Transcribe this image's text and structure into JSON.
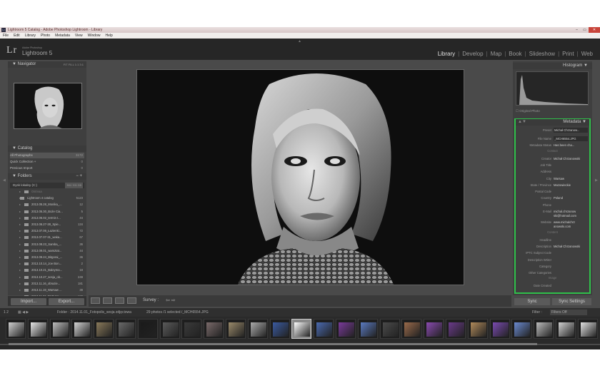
{
  "window": {
    "title": "Lightroom 5 Catalog - Adobe Photoshop Lightroom - Library",
    "icon": "Lr",
    "controls": [
      "–",
      "▭",
      "✕"
    ]
  },
  "menu": [
    "File",
    "Edit",
    "Library",
    "Photo",
    "Metadata",
    "View",
    "Window",
    "Help"
  ],
  "identity": {
    "logo": "Lr",
    "sub1": "Adobe Photoshop",
    "sub2": "Lightroom 5"
  },
  "modules": [
    {
      "label": "Library",
      "active": true
    },
    {
      "label": "Develop"
    },
    {
      "label": "Map"
    },
    {
      "label": "Book"
    },
    {
      "label": "Slideshow"
    },
    {
      "label": "Print"
    },
    {
      "label": "Web"
    }
  ],
  "left": {
    "navigator": {
      "title": "Navigator",
      "zoom": "FIT   FILL   1:1   3:1"
    },
    "catalog": {
      "title": "Catalog",
      "items": [
        {
          "label": "All Photographs",
          "count": "3172"
        },
        {
          "label": "Quick Collection +",
          "count": "0"
        },
        {
          "label": "Previous Import",
          "count": "0"
        }
      ]
    },
    "folders": {
      "title": "Folders",
      "volume": {
        "label": "Dysk lokalny (C:)",
        "space": "306 / 931 GB"
      },
      "items": [
        {
          "label": "Ostrvaa",
          "count": ""
        },
        {
          "label": "Lightroom 4 catalog",
          "count": "5123"
        },
        {
          "label": "2013.05.28_Monika_...",
          "count": "12"
        },
        {
          "label": "2013.05.30_Boże Cia...",
          "count": "5"
        },
        {
          "label": "2013.06.02_termin t...",
          "count": "44"
        },
        {
          "label": "2013.06.27-28_Spie...",
          "count": "134"
        },
        {
          "label": "2013.07.06_Łazienki...",
          "count": "72"
        },
        {
          "label": "2013.07.07-31_waka...",
          "count": "67"
        },
        {
          "label": "2013.08.23_Samba_...",
          "count": "36"
        },
        {
          "label": "2013.09.01_warsztat...",
          "count": "44"
        },
        {
          "label": "2013.09.24_Bitgorai_...",
          "count": "36"
        },
        {
          "label": "2013.10.14_Joe Bon...",
          "count": "2"
        },
        {
          "label": "2013.10.21_Baleyma...",
          "count": "18"
        },
        {
          "label": "2013.10.27_sesja_ob...",
          "count": "249"
        },
        {
          "label": "2013.11.16_obrazie...",
          "count": "181"
        },
        {
          "label": "2013.11.19_Warsaw ...",
          "count": "38"
        },
        {
          "label": "2013.11.21_D&D Int...",
          "count": "130"
        }
      ]
    },
    "buttons": {
      "import": "Import...",
      "export": "Export..."
    }
  },
  "toolbar": {
    "survey": "Survey :",
    "arrows": "⇦ ⇨"
  },
  "right": {
    "histogram": {
      "title": "Histogram",
      "original": "Original Photo"
    },
    "metadata": {
      "title": "Metadata",
      "preset_label": "Preset",
      "preset_value": "Michał Chrzanow...",
      "rows": [
        {
          "k": "File Name",
          "v": "_MCH6554.JPG",
          "box": true
        },
        {
          "k": "Metadata Status",
          "v": "Has been cha...",
          "box": false
        },
        {
          "hdr": "Contact"
        },
        {
          "k": "Creator",
          "v": "Michał Chrzanowski",
          "box": false
        },
        {
          "k": "Job Title",
          "v": "",
          "box": false
        },
        {
          "k": "Address",
          "v": "",
          "box": false
        },
        {
          "k": "City",
          "v": "Warsaw",
          "box": false
        },
        {
          "k": "State / Province",
          "v": "Mazowieckie",
          "box": false
        },
        {
          "k": "Postal Code",
          "v": "",
          "box": false
        },
        {
          "k": "Country",
          "v": "Poland",
          "box": false
        },
        {
          "k": "Phone",
          "v": "",
          "box": false
        },
        {
          "k": "E-Mail",
          "v": "michal.chrzanow",
          "v2": "ski@hotmail.com",
          "box": false
        },
        {
          "k": "Website",
          "v": "www.michalchrz",
          "v2": "anowski.com",
          "box": false
        },
        {
          "hdr": "Content"
        },
        {
          "k": "Headline",
          "v": "",
          "box": false
        },
        {
          "k": "Description",
          "v": "Michał Chrzanowski",
          "box": false
        },
        {
          "k": "IPTC Subject Code",
          "v": "",
          "box": false
        },
        {
          "k": "Description Writer",
          "v": "",
          "box": false
        },
        {
          "k": "Category",
          "v": "",
          "box": false
        },
        {
          "k": "Other Categories",
          "v": "",
          "box": false
        },
        {
          "hdr": "Image"
        },
        {
          "k": "Date Created",
          "v": "",
          "box": false
        }
      ]
    },
    "buttons": {
      "sync": "Sync",
      "sync_settings": "Sync Settings"
    }
  },
  "filmbar": {
    "pages": "1  2",
    "path": "Folder : 2014.11.01_Fotopolis_sesja zdjęciowa",
    "count": "29 photos /1 selected /_MCH6554.JPG",
    "filter_label": "Filter :",
    "filter_value": "Filters Off"
  },
  "colors": {
    "highlight": "#2fbf4a",
    "bg": "#4a4a4a",
    "panel": "#3f3f3f"
  }
}
